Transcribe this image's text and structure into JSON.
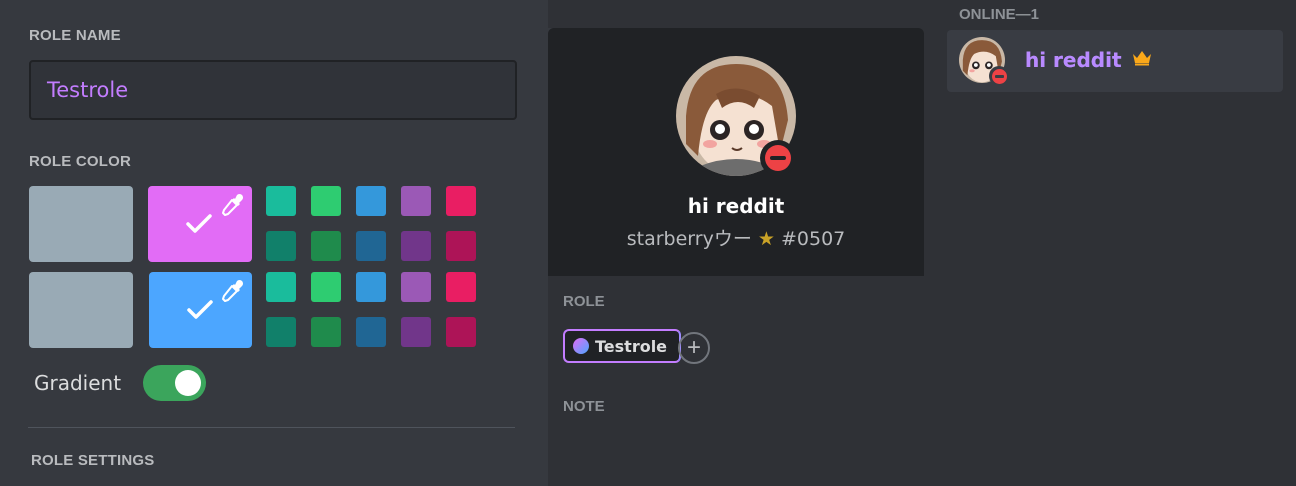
{
  "role_editor": {
    "role_name_label": "ROLE NAME",
    "role_name_value": "Testrole",
    "role_color_label": "ROLE COLOR",
    "default_color": "#99aab5",
    "selected_colors": [
      "#e26cf6",
      "#4ca6ff"
    ],
    "swatch_colors_row1": [
      "#1abc9c",
      "#2ecc71",
      "#3498db",
      "#9b59b6",
      "#e91e63"
    ],
    "swatch_colors_row2": [
      "#11806a",
      "#1f8b4c",
      "#206694",
      "#71368a",
      "#ad1457"
    ],
    "gradient_label": "Gradient",
    "gradient_enabled": true,
    "role_settings_label": "ROLE SETTINGS"
  },
  "profile_popout": {
    "display_name": "hi reddit",
    "tag": "starberryウー",
    "star": "★",
    "discriminator": "#0507",
    "role_label": "ROLE",
    "role_pill": "Testrole",
    "add_role": "+",
    "note_label": "NOTE",
    "status": "do-not-disturb"
  },
  "member_list": {
    "header": "ONLINE—1",
    "member_name": "hi reddit",
    "owner_icon": "crown-icon"
  }
}
